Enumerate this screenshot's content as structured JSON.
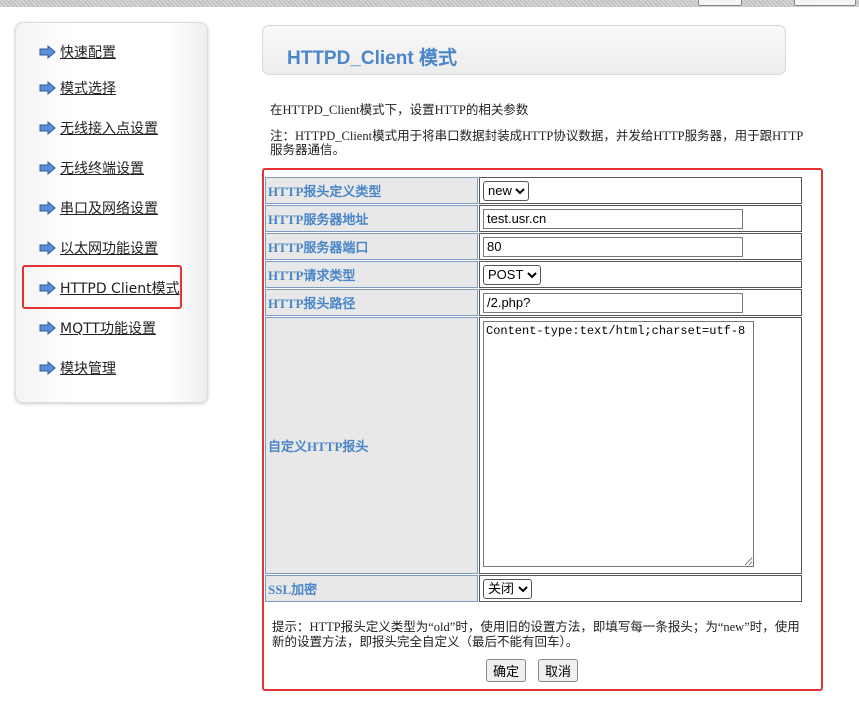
{
  "sidebar": {
    "items": [
      {
        "label": "快速配置"
      },
      {
        "label": "模式选择"
      },
      {
        "label": "无线接入点设置"
      },
      {
        "label": "无线终端设置"
      },
      {
        "label": "串口及网络设置"
      },
      {
        "label": "以太网功能设置"
      },
      {
        "label": "HTTPD Client模式"
      },
      {
        "label": "MQTT功能设置"
      },
      {
        "label": "模块管理"
      }
    ],
    "active_index": 6
  },
  "page": {
    "title": "HTTPD_Client 模式",
    "intro": "在HTTPD_Client模式下，设置HTTP的相关参数",
    "note": "注：HTTPD_Client模式用于将串口数据封装成HTTP协议数据，并发给HTTP服务器，用于跟HTTP服务器通信。"
  },
  "form": {
    "header_type": {
      "label": "HTTP报头定义类型",
      "value": "new"
    },
    "server_addr": {
      "label": "HTTP服务器地址",
      "value": "test.usr.cn"
    },
    "server_port": {
      "label": "HTTP服务器端口",
      "value": "80"
    },
    "request_type": {
      "label": "HTTP请求类型",
      "value": "POST"
    },
    "header_path": {
      "label": "HTTP报头路径",
      "value": "/2.php?"
    },
    "custom_header": {
      "label": "自定义HTTP报头",
      "value": "Content-type:text/html;charset=utf-8"
    },
    "ssl": {
      "label": "SSL加密",
      "value": "关闭"
    },
    "hint": "提示：HTTP报头定义类型为“old”时，使用旧的设置方法，即填写每一条报头；为“new”时，使用新的设置方法，即报头完全自定义（最后不能有回车）。",
    "ok_label": "确定",
    "cancel_label": "取消"
  },
  "colors": {
    "accent": "#4a86c8",
    "highlight": "#e53333"
  }
}
